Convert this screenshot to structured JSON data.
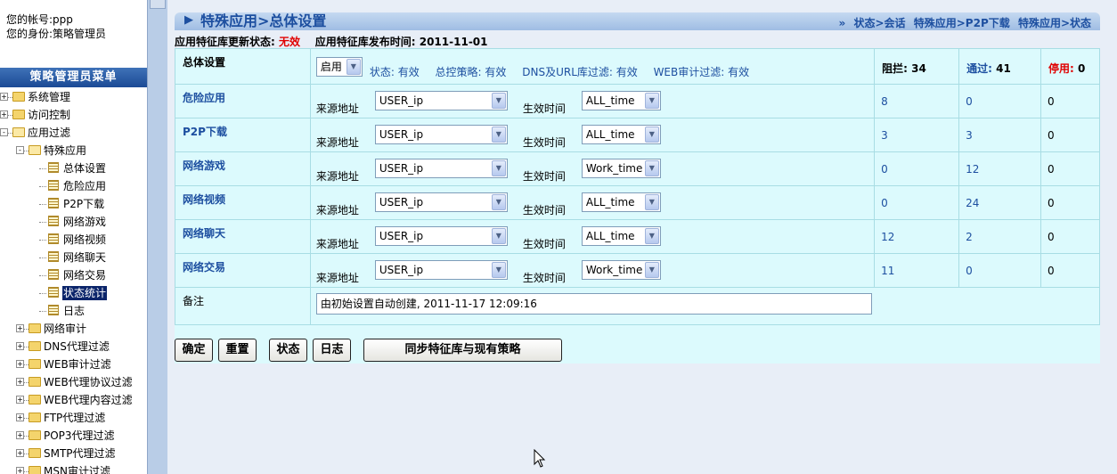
{
  "sidebar": {
    "account_label": "您的帐号:",
    "account": "ppp",
    "role_label": "您的身份:",
    "role": "策略管理员",
    "menu_title": "策略管理员菜单",
    "tree": [
      {
        "label": "系统管理",
        "level": 0,
        "expander": "+",
        "icon": "folder-icon"
      },
      {
        "label": "访问控制",
        "level": 0,
        "expander": "+",
        "icon": "folder-icon"
      },
      {
        "label": "应用过滤",
        "level": 0,
        "expander": "-",
        "icon": "folder-open-icon"
      },
      {
        "label": "特殊应用",
        "level": 1,
        "expander": "-",
        "icon": "folder-open-icon"
      },
      {
        "label": "总体设置",
        "level": 2,
        "icon": "page-icon"
      },
      {
        "label": "危险应用",
        "level": 2,
        "icon": "page-icon"
      },
      {
        "label": "P2P下载",
        "level": 2,
        "icon": "page-icon"
      },
      {
        "label": "网络游戏",
        "level": 2,
        "icon": "page-icon"
      },
      {
        "label": "网络视频",
        "level": 2,
        "icon": "page-icon"
      },
      {
        "label": "网络聊天",
        "level": 2,
        "icon": "page-icon"
      },
      {
        "label": "网络交易",
        "level": 2,
        "icon": "page-icon"
      },
      {
        "label": "状态统计",
        "level": 2,
        "icon": "page-icon",
        "selected": true
      },
      {
        "label": "日志",
        "level": 2,
        "icon": "page-icon"
      },
      {
        "label": "网络审计",
        "level": 1,
        "expander": "+",
        "icon": "folder-icon"
      },
      {
        "label": "DNS代理过滤",
        "level": 1,
        "expander": "+",
        "icon": "folder-icon"
      },
      {
        "label": "WEB审计过滤",
        "level": 1,
        "expander": "+",
        "icon": "folder-icon"
      },
      {
        "label": "WEB代理协议过滤",
        "level": 1,
        "expander": "+",
        "icon": "folder-icon"
      },
      {
        "label": "WEB代理内容过滤",
        "level": 1,
        "expander": "+",
        "icon": "folder-icon"
      },
      {
        "label": "FTP代理过滤",
        "level": 1,
        "expander": "+",
        "icon": "folder-icon"
      },
      {
        "label": "POP3代理过滤",
        "level": 1,
        "expander": "+",
        "icon": "folder-icon"
      },
      {
        "label": "SMTP代理过滤",
        "level": 1,
        "expander": "+",
        "icon": "folder-icon"
      },
      {
        "label": "MSN审计过滤",
        "level": 1,
        "expander": "+",
        "icon": "folder-icon"
      }
    ]
  },
  "header": {
    "title": "特殊应用>总体设置",
    "crumb_prefix": "»",
    "crumbs": [
      "状态>会话",
      "特殊应用>P2P下载",
      "特殊应用>状态"
    ]
  },
  "status": {
    "update_label": "应用特征库更新状态:",
    "update_value": "无效",
    "publish_label": "应用特征库发布时间:",
    "publish_value": "2011-11-01"
  },
  "overall": {
    "label": "总体设置",
    "enable_value": "启用",
    "info": [
      "状态: 有效",
      "总控策略: 有效",
      "DNS及URL库过滤: 有效",
      "WEB审计过滤: 有效"
    ],
    "blocked_label": "阻拦:",
    "blocked": "34",
    "passed_label": "通过:",
    "passed": "41",
    "disabled_label": "停用:",
    "disabled": "0"
  },
  "labels": {
    "source": "来源地址",
    "time": "生效时间",
    "note": "备注"
  },
  "rows": [
    {
      "name": "危险应用",
      "source": "USER_ip",
      "time": "ALL_time",
      "blocked": "8",
      "passed": "0",
      "disabled": "0"
    },
    {
      "name": "P2P下载",
      "source": "USER_ip",
      "time": "ALL_time",
      "blocked": "3",
      "passed": "3",
      "disabled": "0"
    },
    {
      "name": "网络游戏",
      "source": "USER_ip",
      "time": "Work_time",
      "blocked": "0",
      "passed": "12",
      "disabled": "0"
    },
    {
      "name": "网络视频",
      "source": "USER_ip",
      "time": "ALL_time",
      "blocked": "0",
      "passed": "24",
      "disabled": "0"
    },
    {
      "name": "网络聊天",
      "source": "USER_ip",
      "time": "ALL_time",
      "blocked": "12",
      "passed": "2",
      "disabled": "0"
    },
    {
      "name": "网络交易",
      "source": "USER_ip",
      "time": "Work_time",
      "blocked": "11",
      "passed": "0",
      "disabled": "0"
    }
  ],
  "note_value": "由初始设置自动创建, 2011-11-17 12:09:16",
  "buttons": {
    "confirm": "确定",
    "reset": "重置",
    "status": "状态",
    "log": "日志",
    "sync": "同步特征库与现有策略"
  }
}
